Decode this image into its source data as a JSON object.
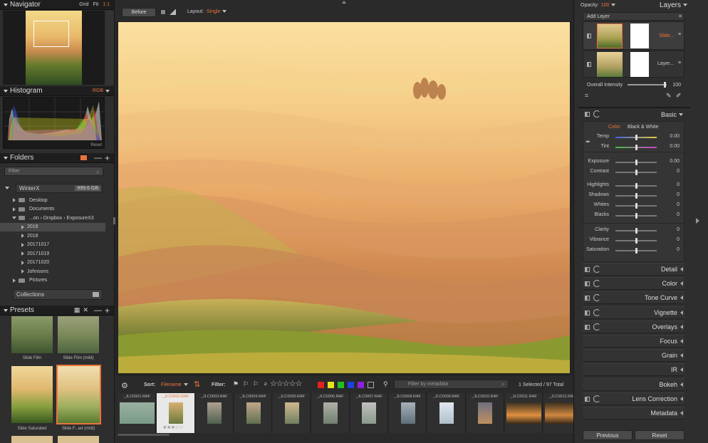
{
  "navigator": {
    "title": "Navigator",
    "grid": "Grid",
    "fit": "Fit",
    "one": "1:1"
  },
  "histogram": {
    "title": "Histogram",
    "mode": "RGB",
    "reset": "Reset"
  },
  "folders": {
    "title": "Folders",
    "filter_placeholder": "Filter",
    "volume": "WinterX",
    "volume_size": "999.6 GB",
    "items": [
      {
        "label": "Desktop",
        "indent": 1
      },
      {
        "label": "Documents",
        "indent": 1
      },
      {
        "label": "...on › Dropbox › ExposureX3",
        "indent": 1
      },
      {
        "label": "2016",
        "indent": 2,
        "selected": true
      },
      {
        "label": "2018",
        "indent": 2
      },
      {
        "label": "20171017",
        "indent": 2
      },
      {
        "label": "20171019",
        "indent": 2
      },
      {
        "label": "20171020",
        "indent": 2
      },
      {
        "label": "Johnsons",
        "indent": 2
      },
      {
        "label": "Pictures",
        "indent": 1
      }
    ],
    "collections": "Collections"
  },
  "presets": {
    "title": "Presets",
    "items": [
      "Slide Film",
      "Slide Film (mild)",
      "Slide Saturated",
      "Slide F...ed (mild)"
    ]
  },
  "toolbar": {
    "before": "Before",
    "layout_label": "Layout:",
    "layout_value": "Single"
  },
  "filmstrip": {
    "sort_label": "Sort:",
    "sort_value": "Filename",
    "filter_label": "Filter:",
    "metadata_placeholder": "Filter by metadata",
    "status": "1 Selected / 97 Total",
    "files": [
      "_JLC0001.RAF",
      "_JLC0002.RAF",
      "_JLC0003.RAF",
      "_JLC0004.RAF",
      "_JLC0005.RAF",
      "_JLC0006.RAF",
      "_JLC0007.RAF",
      "_JLC0008.RAF",
      "_JLC0009.RAF",
      "_JLC0010.RAF",
      "_JLC0011.RAF",
      "_JLC0012.RAF"
    ],
    "selected_index": 1,
    "color_labels": [
      "#e82020",
      "#e8e020",
      "#20c020",
      "#2040e0",
      "#9020e0"
    ]
  },
  "layers": {
    "opacity_label": "Opacity:",
    "opacity_value": "100",
    "title": "Layers",
    "add_layer": "Add Layer",
    "layer1": "Slide...",
    "layer2": "Layer...",
    "intensity_label": "Overall Intensity",
    "intensity_value": "100",
    "intensity_fraction": 0.95
  },
  "basic": {
    "title": "Basic",
    "color": "Color",
    "bw": "Black & White",
    "adjustments": [
      {
        "label": "Temp",
        "value": "0.00",
        "pos": 0.5
      },
      {
        "label": "Tint",
        "value": "0.00",
        "pos": 0.5
      },
      {
        "label": "Exposure",
        "value": "0.00",
        "pos": 0.5
      },
      {
        "label": "Contrast",
        "value": "0",
        "pos": 0.5
      },
      {
        "label": "Highlights",
        "value": "0",
        "pos": 0.5
      },
      {
        "label": "Shadows",
        "value": "0",
        "pos": 0.5
      },
      {
        "label": "Whites",
        "value": "0",
        "pos": 0.5
      },
      {
        "label": "Blacks",
        "value": "0",
        "pos": 0.5
      },
      {
        "label": "Clarity",
        "value": "0",
        "pos": 0.5
      },
      {
        "label": "Vibrance",
        "value": "0",
        "pos": 0.5
      },
      {
        "label": "Saturation",
        "value": "0",
        "pos": 0.5
      }
    ]
  },
  "panels": [
    "Detail",
    "Color",
    "Tone Curve",
    "Vignette",
    "Overlays",
    "Focus",
    "Grain",
    "IR",
    "Bokeh",
    "Lens Correction",
    "Metadata"
  ],
  "footer": {
    "previous": "Previous",
    "reset": "Reset"
  }
}
